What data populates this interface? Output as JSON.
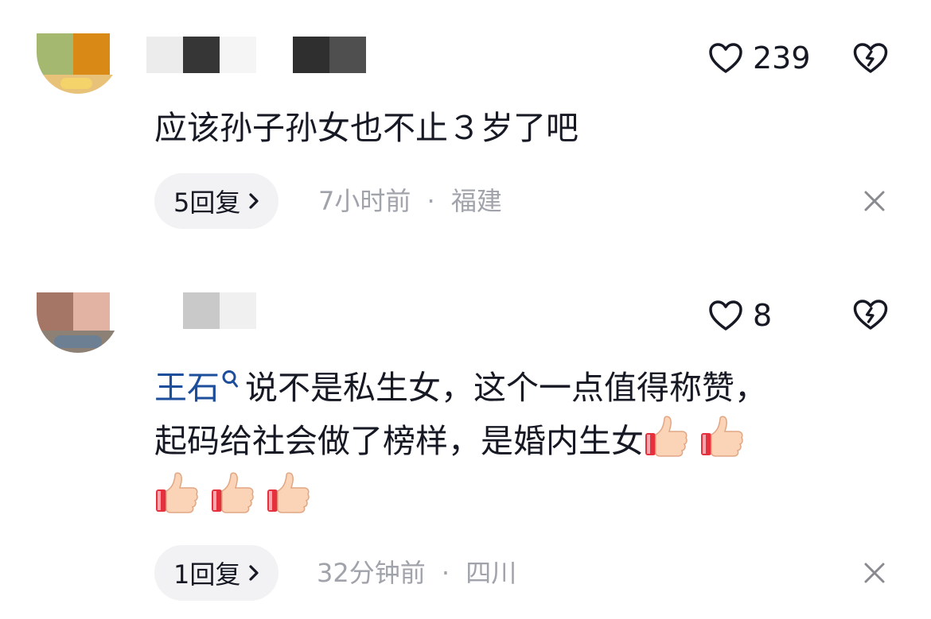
{
  "comments": [
    {
      "likes": "239",
      "text": "应该孙子孙女也不止３岁了吧",
      "reply_label": "5回复",
      "time": "7小时前",
      "separator": "·",
      "location": "福建"
    },
    {
      "likes": "8",
      "mention": "王石",
      "text_line1": "说不是私生女，这个一点值得称赞，",
      "text_line2": "起码给社会做了榜样，是婚内生女",
      "reply_label": "1回复",
      "time": "32分钟前",
      "separator": "·",
      "location": "四川",
      "emoji_count": 5,
      "emoji_name": "thumbs-up"
    }
  ],
  "colors": {
    "mention": "#1c4e9c",
    "meta": "#a1a3ab",
    "reply_bg": "#f2f2f4"
  }
}
